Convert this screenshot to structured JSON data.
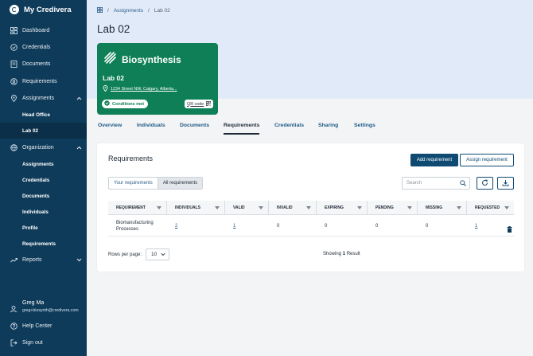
{
  "brand": {
    "name": "My Credivera"
  },
  "sidebar": {
    "items": [
      {
        "label": "Dashboard",
        "icon": "dashboard-icon"
      },
      {
        "label": "Credentials",
        "icon": "credential-check-icon"
      },
      {
        "label": "Documents",
        "icon": "document-icon"
      },
      {
        "label": "Requirements",
        "icon": "requirements-icon"
      },
      {
        "label": "Assignments",
        "icon": "location-pin-icon"
      },
      {
        "label": "Organization",
        "icon": "globe-icon"
      },
      {
        "label": "Reports",
        "icon": "trend-icon"
      }
    ],
    "assignments_sub": [
      "Head Office",
      "Lab 02"
    ],
    "organization_sub": [
      "Assignments",
      "Credentials",
      "Documents",
      "Individuals",
      "Profile",
      "Requirements"
    ],
    "user": {
      "name": "Greg Ma",
      "email": "greg+biosynth@credivera.com"
    },
    "help": "Help Center",
    "signout": "Sign out"
  },
  "breadcrumb": {
    "root": "Assignments",
    "current": "Lab 02"
  },
  "page": {
    "title": "Lab 02"
  },
  "card": {
    "org_name": "Biosynthesis",
    "title": "Lab 02",
    "address": "1234 Street NW, Calgary, Alberta...",
    "status": "Conditions met",
    "qr_label": "QR code"
  },
  "tabs": [
    "Overview",
    "Individuals",
    "Documents",
    "Requirements",
    "Credentials",
    "Sharing",
    "Settings"
  ],
  "panel": {
    "title": "Requirements",
    "add_button": "Add requirement",
    "assign_button": "Assign requirement",
    "toggle": [
      "Your requirements",
      "All requirements"
    ],
    "search_placeholder": "Search"
  },
  "table": {
    "headers": [
      "REQUIREMENT",
      "INDIVIDUALS",
      "VALID",
      "INVALID",
      "EXPIRING",
      "PENDING",
      "MISSING",
      "REQUESTED"
    ],
    "rows": [
      {
        "requirement": "Biomanufacturing Processes",
        "individuals": "2",
        "valid": "1",
        "invalid": "0",
        "expiring": "0",
        "pending": "0",
        "missing": "0",
        "requested": "1"
      }
    ]
  },
  "pagination": {
    "rows_label": "Rows per page:",
    "rows_value": "10",
    "showing_prefix": "Showing",
    "showing_count": "1",
    "showing_suffix": "Result"
  },
  "colors": {
    "sidebar": "#0f3b5a",
    "card": "#0e7f57",
    "primary": "#0f4a72",
    "band": "#e1eaf8"
  }
}
